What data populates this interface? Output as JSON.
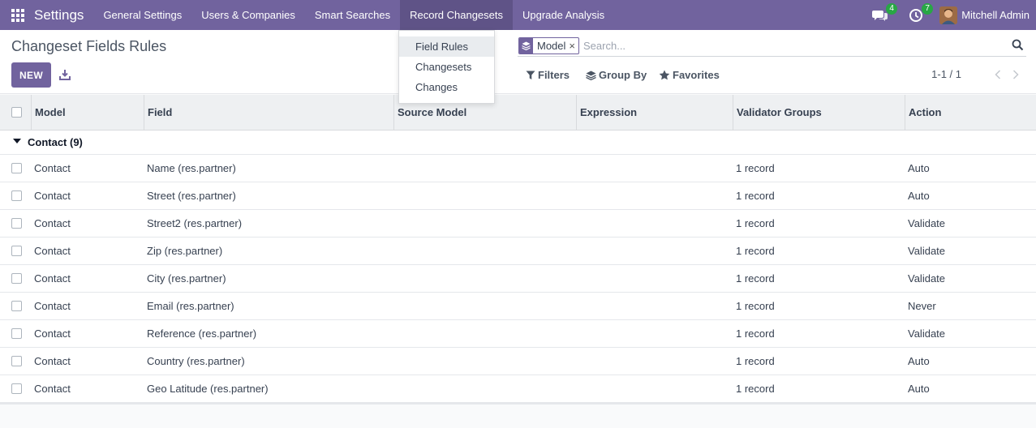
{
  "navbar": {
    "app_title": "Settings",
    "menu": [
      {
        "label": "General Settings"
      },
      {
        "label": "Users & Companies"
      },
      {
        "label": "Smart Searches"
      },
      {
        "label": "Record Changesets"
      },
      {
        "label": "Upgrade Analysis"
      }
    ],
    "messages_count": "4",
    "activities_count": "7",
    "user_name": "Mitchell Admin"
  },
  "dropdown": {
    "items": [
      {
        "label": "Field Rules"
      },
      {
        "label": "Changesets"
      },
      {
        "label": "Changes"
      }
    ]
  },
  "control_panel": {
    "title": "Changeset Fields Rules",
    "new_label": "NEW",
    "facet_value": "Model",
    "facet_remove": "×",
    "search_placeholder": "Search...",
    "filters_label": "Filters",
    "group_by_label": "Group By",
    "favorites_label": "Favorites",
    "pager": "1-1 / 1"
  },
  "table": {
    "columns": [
      "Model",
      "Field",
      "Source Model",
      "Expression",
      "Validator Groups",
      "Action"
    ],
    "group_label": "Contact (9)",
    "rows": [
      {
        "model": "Contact",
        "field": "Name (res.partner)",
        "source_model": "",
        "expression": "",
        "validator_groups": "1 record",
        "action": "Auto"
      },
      {
        "model": "Contact",
        "field": "Street (res.partner)",
        "source_model": "",
        "expression": "",
        "validator_groups": "1 record",
        "action": "Auto"
      },
      {
        "model": "Contact",
        "field": "Street2 (res.partner)",
        "source_model": "",
        "expression": "",
        "validator_groups": "1 record",
        "action": "Validate"
      },
      {
        "model": "Contact",
        "field": "Zip (res.partner)",
        "source_model": "",
        "expression": "",
        "validator_groups": "1 record",
        "action": "Validate"
      },
      {
        "model": "Contact",
        "field": "City (res.partner)",
        "source_model": "",
        "expression": "",
        "validator_groups": "1 record",
        "action": "Validate"
      },
      {
        "model": "Contact",
        "field": "Email (res.partner)",
        "source_model": "",
        "expression": "",
        "validator_groups": "1 record",
        "action": "Never"
      },
      {
        "model": "Contact",
        "field": "Reference (res.partner)",
        "source_model": "",
        "expression": "",
        "validator_groups": "1 record",
        "action": "Validate"
      },
      {
        "model": "Contact",
        "field": "Country (res.partner)",
        "source_model": "",
        "expression": "",
        "validator_groups": "1 record",
        "action": "Auto"
      },
      {
        "model": "Contact",
        "field": "Geo Latitude (res.partner)",
        "source_model": "",
        "expression": "",
        "validator_groups": "1 record",
        "action": "Auto"
      }
    ]
  },
  "icons": {
    "apps": "apps-grid-icon",
    "messages": "chat-icon",
    "activities": "clock-icon",
    "download": "download-icon",
    "facet": "layers-icon",
    "search": "search-icon",
    "filter": "funnel-icon",
    "group_by": "layers-icon",
    "favorites": "star-icon",
    "prev": "chevron-left-icon",
    "next": "chevron-right-icon"
  },
  "colors": {
    "brand": "#71639e",
    "brand_active": "#5f5387",
    "badge": "#28a745",
    "header_bg": "#eef0f2"
  }
}
